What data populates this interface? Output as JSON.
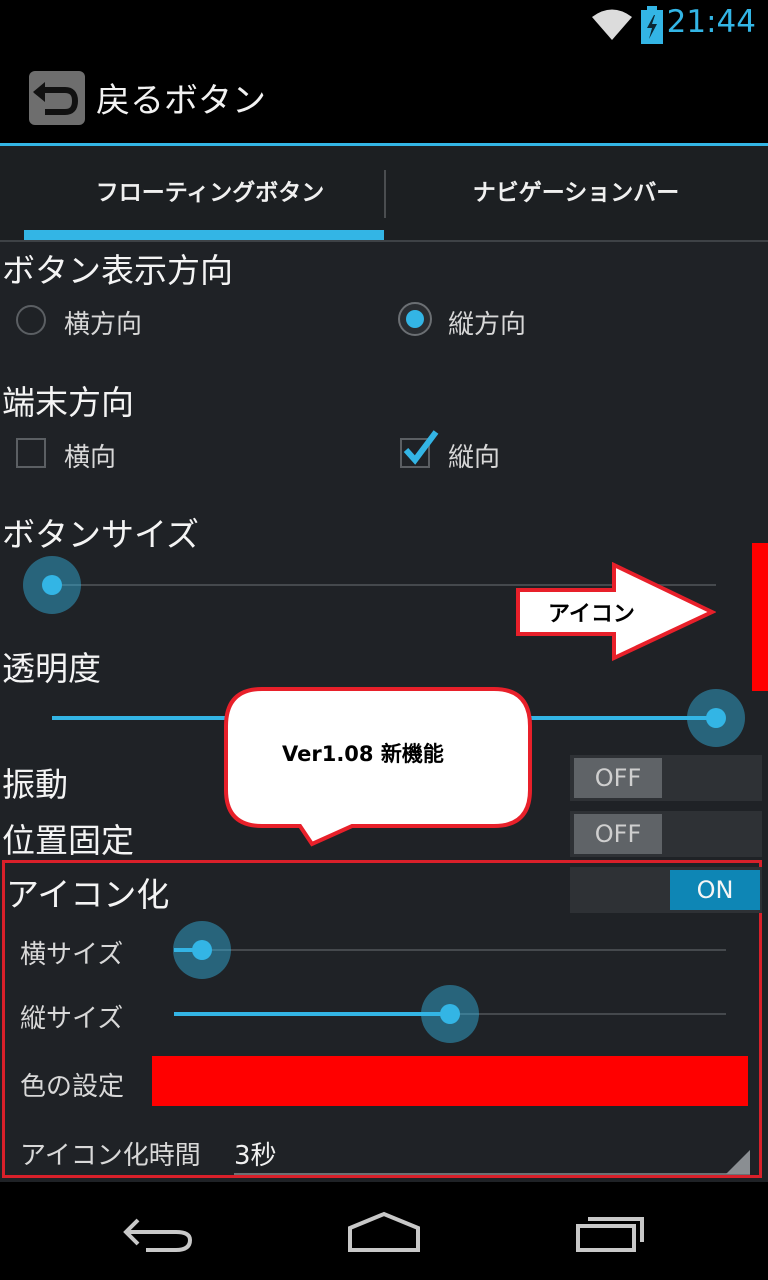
{
  "status_bar": {
    "time": "21:44",
    "accent": "#33b5e5"
  },
  "action_bar": {
    "title": "戻るボタン",
    "icon": "back-arrow-icon"
  },
  "tabs": [
    {
      "label": "フローティングボタン",
      "selected": true
    },
    {
      "label": "ナビゲーションバー",
      "selected": false
    }
  ],
  "button_orientation": {
    "title": "ボタン表示方向",
    "options": [
      {
        "label": "横方向",
        "selected": false
      },
      {
        "label": "縦方向",
        "selected": true
      }
    ]
  },
  "device_orientation": {
    "title": "端末方向",
    "options": [
      {
        "label": "横向",
        "checked": false
      },
      {
        "label": "縦向",
        "checked": true
      }
    ]
  },
  "button_size": {
    "title": "ボタンサイズ",
    "value_fraction": 0.0
  },
  "transparency": {
    "title": "透明度",
    "value_fraction": 1.0
  },
  "vibration": {
    "title": "振動",
    "state": "OFF"
  },
  "position_lock": {
    "title": "位置固定",
    "state": "OFF"
  },
  "iconify": {
    "title": "アイコン化",
    "state": "ON",
    "width": {
      "label": "横サイズ",
      "value_fraction": 0.05
    },
    "height": {
      "label": "縦サイズ",
      "value_fraction": 0.5
    },
    "color": {
      "label": "色の設定",
      "value": "#ff0000"
    },
    "time": {
      "label": "アイコン化時間",
      "value": "3秒"
    }
  },
  "annotations": {
    "arrow_text": "アイコン",
    "bubble_text": "Ver1.08 新機能",
    "frame_color": "#d9202a"
  }
}
